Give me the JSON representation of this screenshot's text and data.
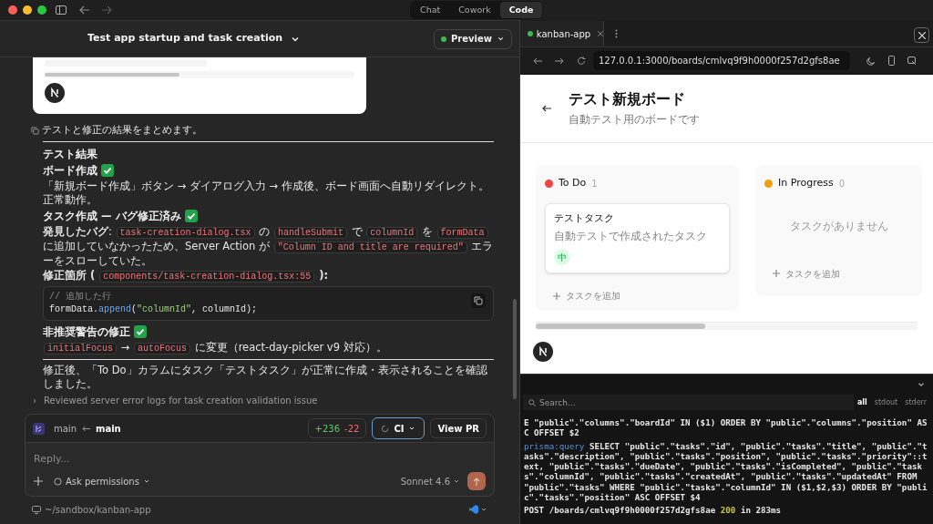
{
  "window": {
    "mode_tabs": [
      {
        "label": "Chat",
        "selected": false
      },
      {
        "label": "Cowork",
        "selected": false
      },
      {
        "label": "Code",
        "selected": true
      }
    ]
  },
  "chat": {
    "title": "Test app startup and task creation",
    "preview": "Preview"
  },
  "message": {
    "intro": "テストと修正の結果をまとめます。",
    "blocks": [
      {
        "kind": "rule"
      },
      {
        "kind": "heading",
        "text": "テスト結果",
        "done": false
      },
      {
        "kind": "heading",
        "text": "ボード作成",
        "done": true
      },
      {
        "kind": "paragraph",
        "segments": [
          {
            "kind": "text",
            "text": "「新規ボード作成」ボタン → ダイアログ入力 → 作成後、ボード画面へ自動リダイレクト。正常動作。"
          }
        ]
      },
      {
        "kind": "heading",
        "text": "タスク作成 — バグ修正済み",
        "done": true
      },
      {
        "kind": "paragraph",
        "segments": [
          {
            "kind": "bold",
            "text": "発見したバグ"
          },
          {
            "kind": "text",
            "text": ": "
          },
          {
            "kind": "code",
            "text": "task-creation-dialog.tsx"
          },
          {
            "kind": "text",
            "text": " の "
          },
          {
            "kind": "code",
            "text": "handleSubmit"
          },
          {
            "kind": "text",
            "text": " で "
          },
          {
            "kind": "code",
            "text": "columnId"
          },
          {
            "kind": "text",
            "text": " を "
          },
          {
            "kind": "code",
            "text": "formData"
          },
          {
            "kind": "text",
            "text": " に追加していなかったため、Server Action が "
          },
          {
            "kind": "code",
            "text": "\"Column ID and title are required\""
          },
          {
            "kind": "text",
            "text": " エラーをスローしていた。"
          }
        ]
      },
      {
        "kind": "paragraph",
        "segments": [
          {
            "kind": "bold",
            "text": "修正箇所 ( "
          },
          {
            "kind": "code",
            "text": "components/task-creation-dialog.tsx:55"
          },
          {
            "kind": "bold",
            "text": " ):"
          }
        ]
      },
      {
        "kind": "code",
        "lines": [
          [
            {
              "kind": "comment",
              "text": "// 追加した行"
            }
          ],
          [
            {
              "kind": "plain",
              "text": "formData."
            },
            {
              "kind": "func",
              "text": "append"
            },
            {
              "kind": "plain",
              "text": "("
            },
            {
              "kind": "string",
              "text": "\"columnId\""
            },
            {
              "kind": "plain",
              "text": ", columnId);"
            }
          ]
        ]
      },
      {
        "kind": "heading",
        "text": "非推奨警告の修正",
        "done": true
      },
      {
        "kind": "paragraph",
        "segments": [
          {
            "kind": "code",
            "text": "initialFocus"
          },
          {
            "kind": "text",
            "text": " → "
          },
          {
            "kind": "code",
            "text": "autoFocus"
          },
          {
            "kind": "text",
            "text": " に変更（react-day-picker v9 対応）。"
          }
        ]
      },
      {
        "kind": "rule"
      },
      {
        "kind": "paragraph",
        "segments": [
          {
            "kind": "text",
            "text": "修正後、「To Do」カラムにタスク「テストタスク」が正常に作成・表示されることを確認しました。"
          }
        ]
      }
    ]
  },
  "reviewed": "Reviewed server error logs for task creation validation issue",
  "branch": {
    "from": "main",
    "to": "main",
    "added": "+236",
    "removed": "-22",
    "ci": "CI",
    "view_pr": "View PR"
  },
  "composer": {
    "placeholder": "Reply...",
    "permissions": "Ask permissions",
    "model": "Sonnet 4.6"
  },
  "footer": {
    "path": "~/sandbox/kanban-app"
  },
  "browser": {
    "tab": "kanban-app",
    "url": "127.0.0.1:3000/boards/cmlvq9f9h0000f257d2gfs8ae"
  },
  "board": {
    "title": "テスト新規ボード",
    "subtitle": "自動テスト用のボードです",
    "columns": [
      {
        "name": "To Do",
        "count": "1",
        "color": "#ef4444",
        "tasks": [
          {
            "title": "テストタスク",
            "description": "自動テストで作成されたタスク",
            "priority": "中"
          }
        ],
        "add": "タスクを追加"
      },
      {
        "name": "In Progress",
        "count": "0",
        "color": "#f59e0b",
        "empty": "タスクがありません",
        "add": "タスクを追加"
      }
    ]
  },
  "logs": {
    "search_placeholder": "Search...",
    "filters": [
      {
        "label": "all",
        "selected": true
      },
      {
        "label": "stdout",
        "selected": false
      },
      {
        "label": "stderr",
        "selected": false
      }
    ],
    "entries": [
      [
        {
          "kind": "plain",
          "text": "E \"public\".\"columns\".\"boardId\" IN ($1) ORDER BY \"public\".\"columns\".\"position\" ASC OFFSET $2"
        }
      ],
      [
        {
          "kind": "tag",
          "text": "prisma:query"
        },
        {
          "kind": "plain",
          "text": " SELECT \"public\".\"tasks\".\"id\", \"public\".\"tasks\".\"title\", \"public\".\"tasks\".\"description\", \"public\".\"tasks\".\"position\", \"public\".\"tasks\".\"priority\"::text, \"public\".\"tasks\".\"dueDate\", \"public\".\"tasks\".\"isCompleted\", \"public\".\"tasks\".\"columnId\", \"public\".\"tasks\".\"createdAt\", \"public\".\"tasks\".\"updatedAt\" FROM \"public\".\"tasks\" WHERE \"public\".\"tasks\".\"columnId\" IN ($1,$2,$3) ORDER BY \"public\".\"tasks\".\"position\" ASC OFFSET $4"
        }
      ],
      [
        {
          "kind": "plain",
          "text": " POST /boards/cmlvq9f9h0000f257d2gfs8ae "
        },
        {
          "kind": "status",
          "text": "200"
        },
        {
          "kind": "plain",
          "text": " in 283ms"
        }
      ]
    ]
  }
}
